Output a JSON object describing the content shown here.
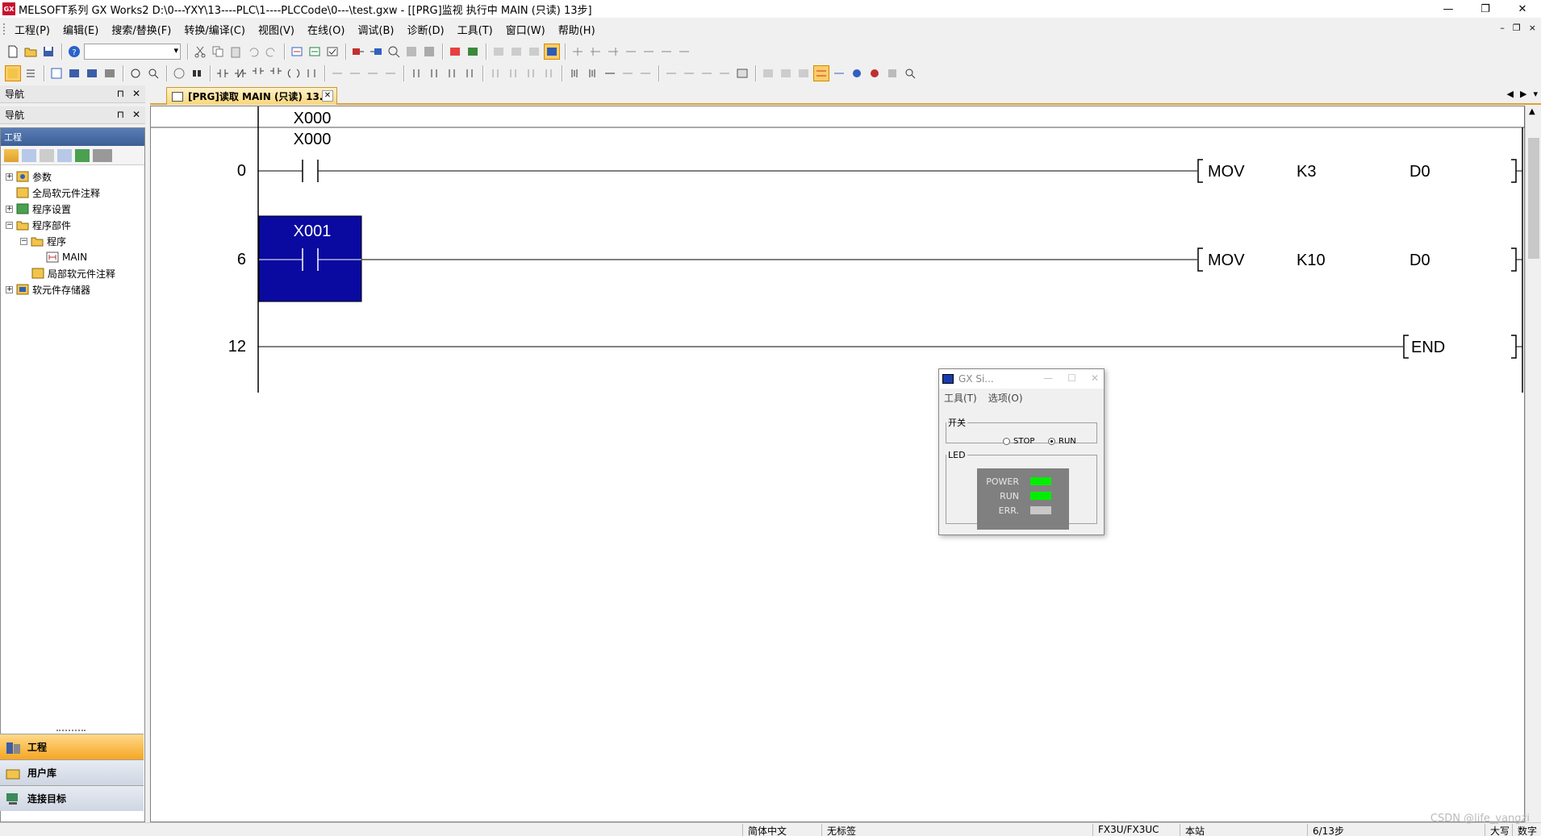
{
  "window": {
    "title": "MELSOFT系列 GX Works2 D:\\0---YXY\\13----PLC\\1----PLCCode\\0---\\test.gxw - [[PRG]监视 执行中 MAIN (只读) 13步]",
    "app_icon_text": "GX",
    "minimize": "—",
    "restore": "❐",
    "close": "✕"
  },
  "menubar": {
    "items": [
      "工程(P)",
      "编辑(E)",
      "搜索/替换(F)",
      "转换/编译(C)",
      "视图(V)",
      "在线(O)",
      "调试(B)",
      "诊断(D)",
      "工具(T)",
      "窗口(W)",
      "帮助(H)"
    ],
    "mdi_minimize": "–",
    "mdi_restore": "❐",
    "mdi_close": "×"
  },
  "navigation": {
    "header1": "导航",
    "header2": "导航",
    "pin": "⊓",
    "close": "✕",
    "panel_title": "工程",
    "tree": [
      {
        "label": "参数",
        "expander": "+"
      },
      {
        "label": "全局软元件注释",
        "expander": ""
      },
      {
        "label": "程序设置",
        "expander": "+"
      },
      {
        "label": "程序部件",
        "expander": "−"
      },
      {
        "label": "程序",
        "expander": "−"
      },
      {
        "label": "MAIN",
        "expander": ""
      },
      {
        "label": "局部软元件注释",
        "expander": ""
      },
      {
        "label": "软元件存储器",
        "expander": "+"
      }
    ],
    "bottom_tabs": [
      "工程",
      "用户库",
      "连接目标"
    ]
  },
  "document": {
    "tab_label": "[PRG]读取 MAIN (只读) 13...",
    "tab_close": "✕",
    "scroll_left": "◀",
    "scroll_right": "▶",
    "scroll_down": "▾"
  },
  "ladder": {
    "header_device": "X000",
    "rungs": [
      {
        "step": "0",
        "contact": "X000",
        "instruction": "MOV",
        "operand1": "K3",
        "operand2": "D0",
        "highlighted": false
      },
      {
        "step": "6",
        "contact": "X001",
        "instruction": "MOV",
        "operand1": "K10",
        "operand2": "D0",
        "highlighted": true
      },
      {
        "step": "12",
        "contact": "",
        "instruction": "END",
        "operand1": "",
        "operand2": "",
        "highlighted": false
      }
    ],
    "highlight_color": "#0a0aa0"
  },
  "simulator": {
    "title": "GX Si...",
    "minimize": "—",
    "maximize": "☐",
    "close": "✕",
    "menu": [
      "工具(T)",
      "选项(O)"
    ],
    "switch_group": "开关",
    "stop_label": "STOP",
    "run_label": "RUN",
    "selected": "RUN",
    "led_group": "LED",
    "leds": [
      {
        "label": "POWER",
        "color": "#00ee00"
      },
      {
        "label": "RUN",
        "color": "#00ee00"
      },
      {
        "label": "ERR.",
        "color": "#c8c8c8"
      }
    ]
  },
  "statusbar": {
    "language": "简体中文",
    "label": "无标签",
    "plc_type": "FX3U/FX3UC",
    "station": "本站",
    "steps": "6/13步",
    "caps": "大写",
    "num": "数字"
  },
  "watermark": "CSDN @life_yangzi"
}
